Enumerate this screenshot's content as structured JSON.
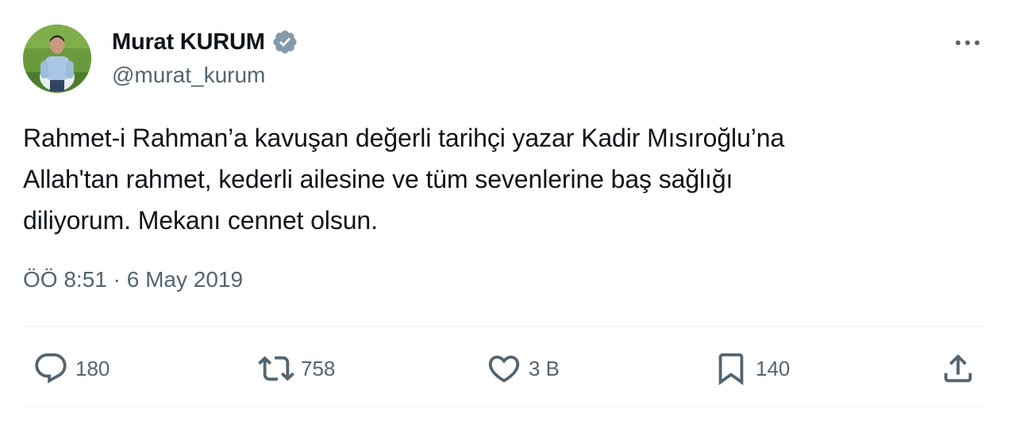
{
  "author": {
    "display_name": "Murat KURUM",
    "handle": "@murat_kurum",
    "verified": true,
    "verified_badge_color": "#829aab"
  },
  "tweet": {
    "text": "Rahmet-i Rahman’a kavuşan değerli tarihçi yazar Kadir Mısıroğlu’na\nAllah'tan rahmet, kederli ailesine ve tüm sevenlerine baş sağlığı\ndiliyorum. Mekanı cennet olsun.",
    "timestamp": "ÖÖ 8:51 · 6 May 2019"
  },
  "actions": {
    "reply": {
      "icon": "reply-icon",
      "count": "180"
    },
    "retweet": {
      "icon": "retweet-icon",
      "count": "758"
    },
    "like": {
      "icon": "heart-icon",
      "count": "3 B"
    },
    "bookmark": {
      "icon": "bookmark-icon",
      "count": "140"
    },
    "share": {
      "icon": "share-icon"
    }
  },
  "menu": {
    "icon": "more-icon"
  },
  "colors": {
    "text_primary": "#0f1419",
    "text_secondary": "#536471",
    "divider": "#eff3f4"
  }
}
